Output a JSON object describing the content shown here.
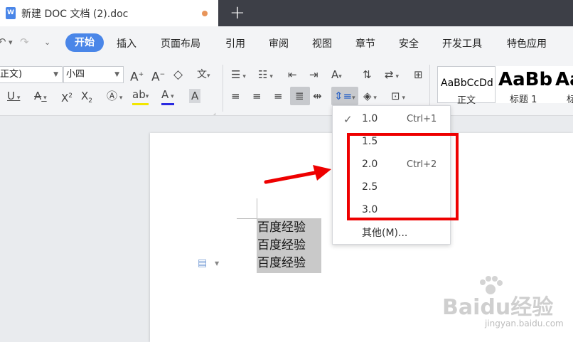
{
  "window": {
    "tab_title": "新建 DOC 文档 (2).doc",
    "doc_icon_letter": "W",
    "new_tab": "+"
  },
  "menu": {
    "items": [
      "开始",
      "插入",
      "页面布局",
      "引用",
      "审阅",
      "视图",
      "章节",
      "安全",
      "开发工具",
      "特色应用"
    ],
    "active": "开始"
  },
  "ribbon": {
    "font_name": "正文)",
    "font_size": "小四",
    "styles": [
      {
        "sample": "AaBbCcDd",
        "label": "正文"
      },
      {
        "sample": "AaBb",
        "label": "标题 1"
      },
      {
        "sample": "Aa",
        "label": "标"
      }
    ]
  },
  "document": {
    "lines": [
      "百度经验",
      "百度经验",
      "百度经验"
    ]
  },
  "line_spacing_menu": {
    "items": [
      {
        "value": "1.0",
        "shortcut": "Ctrl+1",
        "checked": true
      },
      {
        "value": "1.5",
        "shortcut": "",
        "checked": false
      },
      {
        "value": "2.0",
        "shortcut": "Ctrl+2",
        "checked": false
      },
      {
        "value": "2.5",
        "shortcut": "",
        "checked": false
      },
      {
        "value": "3.0",
        "shortcut": "",
        "checked": false
      }
    ],
    "other": "其他(M)..."
  },
  "watermark": {
    "brand": "Baidu经验",
    "url": "jingyan.baidu.com"
  },
  "colors": {
    "accent": "#4a86e8",
    "annotation": "#ee0000",
    "titlebar": "#3d3f47",
    "selection": "#c9c9c9"
  }
}
